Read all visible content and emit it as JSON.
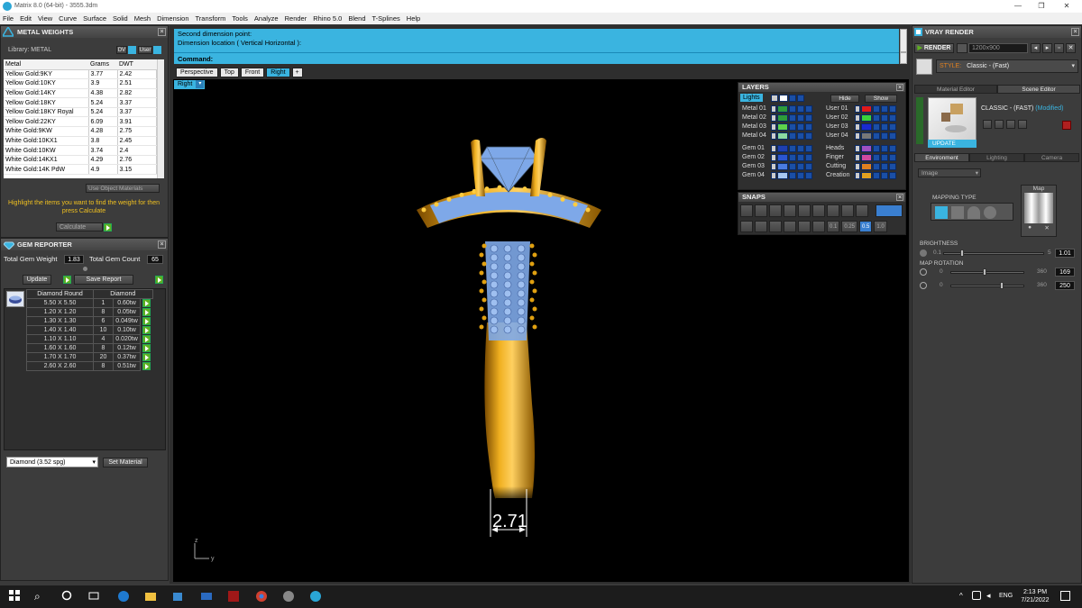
{
  "window": {
    "title": "Matrix 8.0 (64-bit) - 3555.3dm",
    "controls": [
      "—",
      "❐",
      "✕"
    ]
  },
  "menu": [
    "File",
    "Edit",
    "View",
    "Curve",
    "Surface",
    "Solid",
    "Mesh",
    "Dimension",
    "Transform",
    "Tools",
    "Analyze",
    "Render",
    "Rhino 5.0",
    "Blend",
    "T-Splines",
    "Help"
  ],
  "metal_weights": {
    "title": "METAL WEIGHTS",
    "library_label": "Library: METAL",
    "lib_btn_1": "DV",
    "lib_btn_2": "User",
    "columns": [
      "Metal",
      "Grams",
      "DWT"
    ],
    "rows": [
      [
        "Yellow Gold:9KY",
        "3.77",
        "2.42"
      ],
      [
        "Yellow Gold:10KY",
        "3.9",
        "2.51"
      ],
      [
        "Yellow Gold:14KY",
        "4.38",
        "2.82"
      ],
      [
        "Yellow Gold:18KY",
        "5.24",
        "3.37"
      ],
      [
        "Yellow Gold:18KY Royal",
        "5.24",
        "3.37"
      ],
      [
        "Yellow Gold:22KY",
        "6.09",
        "3.91"
      ],
      [
        "White Gold:9KW",
        "4.28",
        "2.75"
      ],
      [
        "White Gold:10KX1",
        "3.8",
        "2.45"
      ],
      [
        "White Gold:10KW",
        "3.74",
        "2.4"
      ],
      [
        "White Gold:14KX1",
        "4.29",
        "2.76"
      ],
      [
        "White Gold:14K PdW",
        "4.9",
        "3.15"
      ]
    ],
    "use_object_materials": "Use Object Materials",
    "hint": "Highlight the items you want to find the weight for then press Calculate",
    "calculate": "Calculate"
  },
  "gem_reporter": {
    "title": "GEM REPORTER",
    "total_weight_label": "Total Gem Weight",
    "total_weight": "1.83",
    "total_count_label": "Total Gem Count",
    "total_count": "65",
    "update": "Update",
    "save_report": "Save Report",
    "col_shape": "Diamond Round",
    "col_material": "Diamond",
    "rows": [
      [
        "5.50 X 5.50",
        "1",
        "0.60tw"
      ],
      [
        "1.20 X 1.20",
        "8",
        "0.05tw"
      ],
      [
        "1.30 X 1.30",
        "6",
        "0.049tw"
      ],
      [
        "1.40 X 1.40",
        "10",
        "0.10tw"
      ],
      [
        "1.10 X 1.10",
        "4",
        "0.020tw"
      ],
      [
        "1.60 X 1.60",
        "8",
        "0.12tw"
      ],
      [
        "1.70 X 1.70",
        "20",
        "0.37tw"
      ],
      [
        "2.60 X 2.60",
        "8",
        "0.51tw"
      ]
    ],
    "material_select": "Diamond    (3.52 spg)",
    "set_material": "Set Material"
  },
  "command": {
    "line1": "Second dimension point:",
    "line2": "Dimension location ( Vertical  Horizontal ):",
    "prompt": "Command:"
  },
  "view_tabs": [
    "Perspective",
    "Top",
    "Front",
    "Right"
  ],
  "active_tab": "Right",
  "viewport_label": "Right",
  "dimension_value": "2.71",
  "axis": {
    "z": "z",
    "y": "y"
  },
  "layers": {
    "title": "LAYERS",
    "lights": "Lights",
    "hide": "Hide",
    "show": "Show",
    "left": [
      {
        "name": "Metal 01",
        "color": "#2e9c3a"
      },
      {
        "name": "Metal 02",
        "color": "#2e9c3a"
      },
      {
        "name": "Metal 03",
        "color": "#5fd34a"
      },
      {
        "name": "Metal 04",
        "color": "#8cd9a0"
      },
      {
        "name": "Gem 01",
        "color": "#1f3fb0"
      },
      {
        "name": "Gem 02",
        "color": "#2b55d0"
      },
      {
        "name": "Gem 03",
        "color": "#4a7be0"
      },
      {
        "name": "Gem 04",
        "color": "#a8c8f0"
      }
    ],
    "right": [
      {
        "name": "User 01",
        "color": "#e01a1a"
      },
      {
        "name": "User 02",
        "color": "#3ad13a"
      },
      {
        "name": "User 03",
        "color": "#1a2ad0"
      },
      {
        "name": "User 04",
        "color": "#777777"
      },
      {
        "name": "Heads",
        "color": "#a050c0"
      },
      {
        "name": "Finger",
        "color": "#d04aa0"
      },
      {
        "name": "Cutting",
        "color": "#e08020"
      },
      {
        "name": "Creation",
        "color": "#e0a020"
      }
    ]
  },
  "snaps": {
    "title": "SNAPS",
    "values": [
      "0.1",
      "0.25",
      "0.5",
      "1.0"
    ]
  },
  "vray": {
    "title": "VRAY RENDER",
    "render": "RENDER",
    "resolution": "1200x900",
    "style_label": "STYLE:",
    "style_value": "Classic - (Fast)",
    "tab_material": "Material Editor",
    "tab_scene": "Scene Editor",
    "preset_name": "CLASSIC - (FAST)",
    "preset_state": "(Modified)",
    "update": "UPDATE",
    "env_tabs": [
      "Environment",
      "Lighting",
      "Camera"
    ],
    "env_select": "Image",
    "mapping_type": "MAPPING TYPE",
    "map_label": "Map",
    "brightness_label": "BRIGHTNESS",
    "brightness_min": "0.1",
    "brightness_max": "5",
    "brightness_value": "1.01",
    "map_rotation_label": "MAP ROTATION",
    "rot1_min": "0",
    "rot1_max": "360",
    "rot1_value": "169",
    "rot2_min": "0",
    "rot2_max": "360",
    "rot2_value": "250"
  },
  "taskbar": {
    "lang": "ENG",
    "time": "2:13 PM",
    "date": "7/21/2022"
  },
  "colors": {
    "accent_blue": "#3ab4e0",
    "gold": "#e0a010",
    "gem_blue": "#7ea8e8",
    "green": "#5fb020"
  }
}
